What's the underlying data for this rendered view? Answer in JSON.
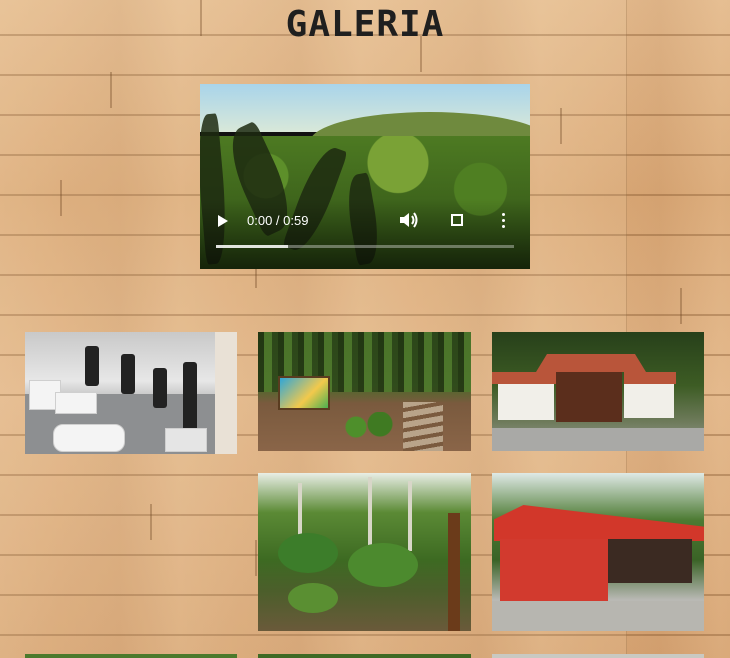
{
  "page": {
    "title": "GALERIA"
  },
  "video": {
    "current_time": "0:00",
    "duration": "0:59",
    "time_label": "0:00 / 0:59",
    "buffered_fraction": 0.24,
    "controls": [
      "play-icon",
      "volume-icon",
      "fullscreen-icon",
      "more-options-icon"
    ]
  },
  "gallery": {
    "images": [
      {
        "subject": "laboratory-microscopes"
      },
      {
        "subject": "garden-path-sign"
      },
      {
        "subject": "white-house-tile-roof"
      },
      {
        "subject": "forest-slope"
      },
      {
        "subject": "red-shed"
      },
      {
        "subject": "partial-row-image-1"
      },
      {
        "subject": "partial-row-image-2"
      },
      {
        "subject": "partial-row-image-3"
      }
    ]
  },
  "colors": {
    "wood_background": "#d8a877",
    "title_text": "#1f1f1f",
    "video_background": "#111111",
    "shed_red": "#d23a2e",
    "roof_tile": "#b9553a"
  }
}
